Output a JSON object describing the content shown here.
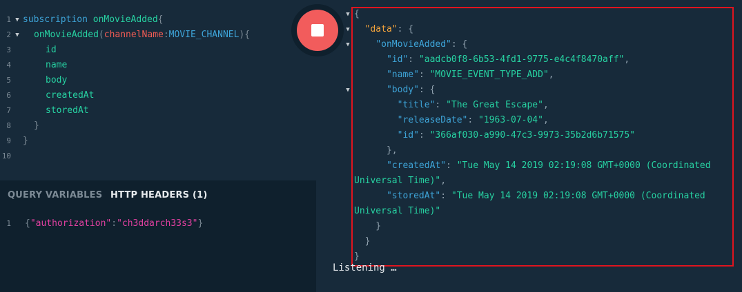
{
  "query_editor": {
    "line_numbers": [
      "1",
      "2",
      "3",
      "4",
      "5",
      "6",
      "7",
      "8",
      "9",
      "10"
    ],
    "keyword": "subscription",
    "operation_name": "onMovieAdded",
    "field_name": "onMovieAdded",
    "arg_name": "channelName",
    "arg_value": "MOVIE_CHANNEL",
    "fields": [
      "id",
      "name",
      "body",
      "createdAt",
      "storedAt"
    ]
  },
  "tabs": {
    "query_variables": "QUERY VARIABLES",
    "http_headers": "HTTP HEADERS (1)"
  },
  "headers_editor": {
    "line_number": "1",
    "key": "\"authorization\"",
    "value": "\"ch3ddarch33s3\""
  },
  "result": {
    "keys": {
      "data": "\"data\"",
      "onMovieAdded": "\"onMovieAdded\"",
      "id": "\"id\"",
      "name": "\"name\"",
      "body": "\"body\"",
      "title": "\"title\"",
      "releaseDate": "\"releaseDate\"",
      "body_id": "\"id\"",
      "createdAt": "\"createdAt\"",
      "storedAt": "\"storedAt\""
    },
    "values": {
      "id": "\"aadcb0f8-6b53-4fd1-9775-e4c4f8470aff\"",
      "name": "\"MOVIE_EVENT_TYPE_ADD\"",
      "title": "\"The Great Escape\"",
      "releaseDate": "\"1963-07-04\"",
      "body_id": "\"366af030-a990-47c3-9973-35b2d6b71575\"",
      "createdAt_1": "\"Tue May 14 2019 02:19:08 GMT+0000 (Coordinated",
      "createdAt_2": "Universal Time)\"",
      "storedAt_1": "\"Tue May 14 2019 02:19:08 GMT+0000 (Coordinated",
      "storedAt_2": "Universal Time)\""
    },
    "status": "Listening …"
  },
  "colors": {
    "highlight_border": "#e0141e",
    "stop_button": "#f25c5c",
    "active_tab": "#e6eaed",
    "inactive_tab": "#7c8a95"
  },
  "icons": {
    "stop": "stop-icon",
    "fold": "fold-arrow-icon"
  }
}
